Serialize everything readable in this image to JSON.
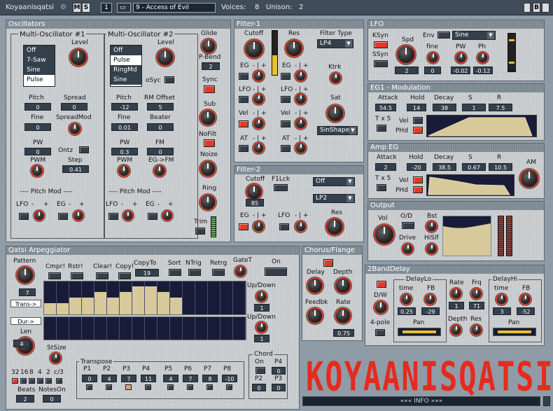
{
  "top": {
    "title": "Koyaanisqatsi",
    "m": "M",
    "s": "S",
    "channel": "1",
    "preset": "9 - Access of Evil",
    "voices_label": "Voices:",
    "voices": "8",
    "unison_label": "Unison:",
    "unison": "2",
    "b": "B"
  },
  "osc": {
    "title": "Oscillators",
    "mo1": "Multi-Oscillator #1",
    "mo2": "Multi-Oscillator #2",
    "list1": [
      "Off",
      "7-Saw",
      "Sine",
      "Pulse"
    ],
    "list2": [
      "Off",
      "Pulse",
      "RingMd",
      "Sine"
    ],
    "level": "Level",
    "pitch": "Pitch",
    "spread": "Spread",
    "pitch1": "0",
    "spread1": "0",
    "fine": "Fine",
    "fine1": "0",
    "spreadmod": "SpreadMod",
    "pw": "PW",
    "pw1": "0",
    "ontz": "Ontz",
    "step": "Step",
    "step1": "0.41",
    "pwm": "PWM",
    "pitchmod": "---- Pitch Mod ----",
    "lfo": "LFO",
    "eg": "EG",
    "minus": "-",
    "plus": "+",
    "pitch2": "-12",
    "rmoffset": "RM Offset",
    "rm2": "5",
    "fine2": "0.01",
    "beater": "Beater",
    "beater2": "0",
    "pw2": "0.3",
    "fm": "FM",
    "fm2": "0",
    "egfm": "EG->FM",
    "osync": "oSyc",
    "glide": "Glide",
    "pbend": "P-Bend",
    "pbend_v": "2",
    "sync": "Sync",
    "sub": "Sub",
    "nofilt": "NoFilt",
    "noize": "Noize",
    "ring": "Ring",
    "trim": "Trim"
  },
  "f1": {
    "title": "Filter-1",
    "cutoff": "Cutoff",
    "res": "Res",
    "ftype": "Filter Type",
    "ftype_v": "LP4",
    "eg": "EG",
    "lfo": "LFO",
    "vel": "Vel",
    "at": "AT",
    "ktrk": "Ktrk",
    "sat": "Sat",
    "sat_v": "SinShape"
  },
  "f2": {
    "title": "Filter-2",
    "cutoff": "Cutoff",
    "cutoff_v": "85",
    "f1lck": "F1Lck",
    "mode": "Off",
    "type": "LP2",
    "eg": "EG",
    "lfo": "LFO",
    "res": "Res"
  },
  "lfo": {
    "title": "LFO",
    "ksyn": "KSyn",
    "ssyn": "SSyn",
    "spd": "Spd",
    "spd_v": "2",
    "env": "Env",
    "wave": "Sine",
    "fine": "fine",
    "fine_v": "0",
    "pw": "PW",
    "pw_v": "-0.02",
    "ph": "Ph",
    "ph_v": "-0.12"
  },
  "eg1": {
    "title": "EG1 - Modulation",
    "attack": "Attack",
    "hold": "Hold",
    "decay": "Decay",
    "s": "S",
    "r": "R",
    "attack_v": "54.5",
    "hold_v": "14",
    "decay_v": "38",
    "s_v": "1",
    "r_v": "7.5",
    "tx5": "T x 5",
    "vel": "Vel",
    "phd": "PHd"
  },
  "amp": {
    "title": "Amp EG",
    "attack": "Attack",
    "hold": "Hold",
    "decay": "Decay",
    "s": "S",
    "r": "R",
    "attack_v": "2",
    "hold_v": "-20",
    "decay_v": "38.5",
    "s_v": "0.67",
    "r_v": "10.5",
    "tx5": "T x 5",
    "vel": "Vel",
    "phd": "PHd",
    "am": "AM"
  },
  "out": {
    "title": "Output",
    "vol": "Vol",
    "od": "O/D",
    "drive": "Drive",
    "bst": "Bst",
    "hislf": "HiSlf"
  },
  "arp": {
    "title": "Qatsi Arpeggiator",
    "pattern": "Pattern",
    "pattern_v": "7",
    "cmpr": "Cmpr!",
    "rstr": "Rstr!",
    "clear": "Clear!",
    "copy": "Copy!",
    "copyto": "CopyTo",
    "copyto_v": "19",
    "sort": "Sort",
    "ntrig": "NTrig",
    "retrg": "Retrg",
    "gatet": "GateT",
    "on": "On",
    "trans": "Trans->",
    "dur": "Dur->",
    "updown": "Up/Down",
    "ud1": "1",
    "ud2": "1",
    "len": "Len",
    "len_v": "4",
    "stsize": "StSize",
    "res_labels": [
      "32",
      "16",
      "8",
      "4",
      "2",
      "c/3"
    ],
    "beats": "Beats",
    "beats_v": "2",
    "noteson": "NotesOn",
    "noteson_v": "0",
    "transpose": "Transpose",
    "tp_labels": [
      "P1",
      "P2",
      "P3",
      "P4",
      "P5",
      "P6",
      "P7",
      "P8"
    ],
    "tp_vals": [
      "0",
      "4",
      "7",
      "11",
      "4",
      "7",
      "8",
      "-10"
    ],
    "chord": "Chord",
    "ch_on": "On",
    "ch_p4": "P4",
    "ch_p4v": "0",
    "ch_p2": "P2",
    "ch_p2v": "0",
    "ch_p3": "P3",
    "ch_p3v": "0",
    "steps": [
      1,
      1,
      2,
      2,
      3,
      2,
      3,
      4,
      4,
      3,
      2,
      0,
      0,
      0,
      0,
      0
    ]
  },
  "chorus": {
    "title": "Chorus/Flange",
    "delay": "Delay",
    "depth": "Depth",
    "feedbk": "Feedbk",
    "rate": "Rate",
    "rate_v": "0.75"
  },
  "bd": {
    "title": "2BandDelay",
    "dlo": "DelayLo",
    "time": "time",
    "fb": "FB",
    "dlo_t": "0.25",
    "dlo_fb": "-29",
    "rate": "Rate",
    "frq": "Frq",
    "rate_v": "1",
    "frq_v": "71",
    "dhi": "DelayHi",
    "dhi_t": "3",
    "dhi_fb": "-52",
    "dw": "D/W",
    "pole": "4-pole",
    "pan": "Pan",
    "depth": "Depth",
    "res": "Res"
  },
  "logo": "KOYAANISQATSI",
  "info": "«««   INFO   »»»"
}
